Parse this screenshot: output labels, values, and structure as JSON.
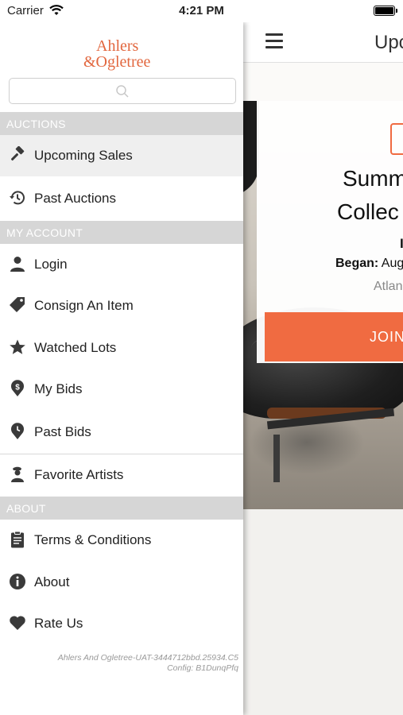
{
  "status_bar": {
    "carrier": "Carrier",
    "time": "4:21 PM"
  },
  "main": {
    "title": "Upc",
    "card": {
      "title_line1": "Summ",
      "title_line2": "Collec",
      "glyph": "I",
      "began_label": "Began:",
      "began_value": "Aug",
      "location": "Atlan",
      "join_label": "JOIN"
    }
  },
  "drawer": {
    "logo_line1": "Ahlers",
    "logo_line2": "&Ogletree",
    "search": {
      "placeholder": ""
    },
    "sections": {
      "auctions": "AUCTIONS",
      "my_account": "MY ACCOUNT",
      "about": "ABOUT"
    },
    "items": {
      "upcoming_sales": "Upcoming Sales",
      "past_auctions": "Past Auctions",
      "login": "Login",
      "consign": "Consign An Item",
      "watched_lots": "Watched Lots",
      "my_bids": "My Bids",
      "past_bids": "Past Bids",
      "favorite_artists": "Favorite Artists",
      "terms": "Terms & Conditions",
      "about": "About",
      "rate_us": "Rate Us"
    },
    "version_line1": "Ahlers And Ogletree-UAT-3444712bbd.25934.C5",
    "version_line2": "Config: B1DunqPfq"
  },
  "colors": {
    "accent": "#f06b41",
    "section_bg": "#d6d6d6",
    "active_bg": "#efefef"
  }
}
